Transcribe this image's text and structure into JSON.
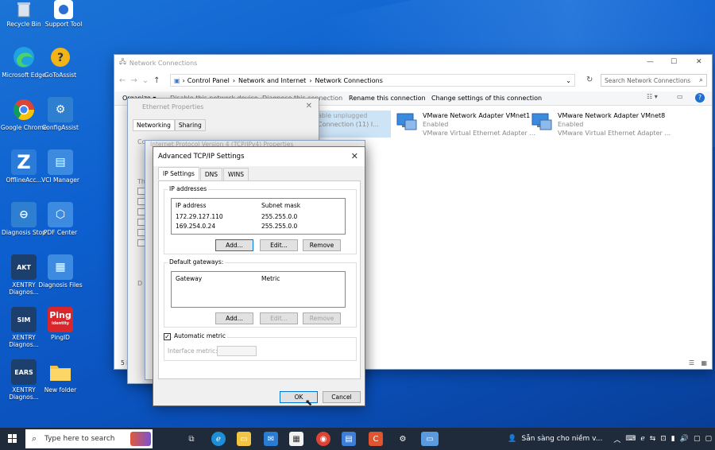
{
  "desktop_icons": [
    {
      "label": "Recycle Bin"
    },
    {
      "label": "Support Tool"
    },
    {
      "label": "Microsoft Edge"
    },
    {
      "label": "GoToAssist"
    },
    {
      "label": "Google Chrome"
    },
    {
      "label": "ConfigAssist"
    },
    {
      "label": "OfflineAcc..."
    },
    {
      "label": "VCI Manager"
    },
    {
      "label": "Diagnosis Stop"
    },
    {
      "label": "PDF Center"
    },
    {
      "label": "XENTRY Diagnos..."
    },
    {
      "label": "Diagnosis Files"
    },
    {
      "label": "XENTRY Diagnos..."
    },
    {
      "label": "PingID"
    },
    {
      "label": "XENTRY Diagnos..."
    },
    {
      "label": "New folder"
    }
  ],
  "desktop_icon_glyphs": {
    "akt": "AKT",
    "sim": "SIM",
    "ears": "EARS",
    "ping": "Ping",
    "ping_sub": "identity",
    "z": "Z"
  },
  "network_window": {
    "title": "Network Connections",
    "controls": [
      "—",
      "☐",
      "✕"
    ],
    "breadcrumb": [
      "Control Panel",
      "Network and Internet",
      "Network Connections"
    ],
    "search_placeholder": "Search Network Connections",
    "commands": [
      "Organize ▾",
      "Disable this network device",
      "Diagnose this connection",
      "Rename this connection",
      "Change settings of this connection"
    ],
    "adapters": [
      {
        "status_partial": "able unplugged",
        "sub_partial": "Connection (11) I..."
      },
      {
        "name": "VMware Network Adapter VMnet1",
        "status": "Enabled",
        "desc": "VMware Virtual Ethernet Adapter ..."
      },
      {
        "name": "VMware Network Adapter VMnet8",
        "status": "Enabled",
        "desc": "VMware Virtual Ethernet Adapter ..."
      }
    ],
    "status_count": "5 items"
  },
  "ethernet_props": {
    "title": "Ethernet Properties",
    "tabs": [
      "Networking",
      "Sharing"
    ],
    "partial_labels": [
      "Conn",
      "Th",
      "D"
    ]
  },
  "ipv4_props": {
    "title": "Internet Protocol Version 4 (TCP/IPv4) Properties"
  },
  "advanced": {
    "title": "Advanced TCP/IP Settings",
    "tabs": [
      "IP Settings",
      "DNS",
      "WINS"
    ],
    "ip_group_label": "IP addresses",
    "ip_headers": [
      "IP address",
      "Subnet mask"
    ],
    "ip_rows": [
      {
        "ip": "172.29.127.110",
        "mask": "255.255.0.0"
      },
      {
        "ip": "169.254.0.24",
        "mask": "255.255.0.0"
      }
    ],
    "ip_buttons": [
      "Add...",
      "Edit...",
      "Remove"
    ],
    "gw_group_label": "Default gateways:",
    "gw_headers": [
      "Gateway",
      "Metric"
    ],
    "gw_buttons": [
      "Add...",
      "Edit...",
      "Remove"
    ],
    "auto_metric_label": "Automatic metric",
    "auto_metric_checked": true,
    "interface_metric_label": "Interface metric:",
    "ok": "OK",
    "cancel": "Cancel"
  },
  "taskbar": {
    "search_placeholder": "Type here to search",
    "notification_text": "Sẵn sàng cho niềm v...",
    "tray_icons": [
      "chevron-up-icon",
      "keyboard-icon",
      "edge-icon",
      "network-icon",
      "display-icon",
      "battery-icon",
      "volume-icon",
      "chat-icon",
      "notification-icon"
    ],
    "tray_glyphs": [
      "︿",
      "⌨",
      "ℯ",
      "⇆",
      "⊡",
      "▮",
      "🔊",
      "▢",
      "▢"
    ]
  },
  "colors": {
    "desktop": "#0d5fcf",
    "taskbar": "#1f2a3a",
    "accent": "#0078d7"
  }
}
